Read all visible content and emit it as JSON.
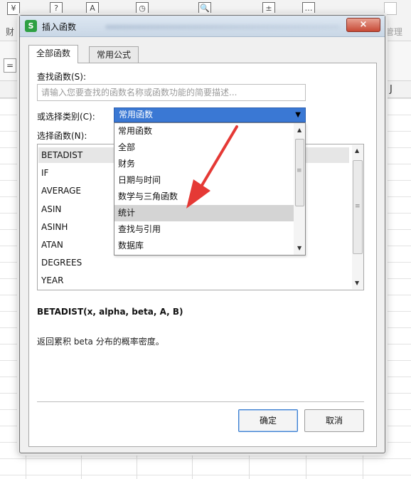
{
  "background": {
    "ribbon_labels": [
      "财",
      "管理"
    ],
    "ribbon_icons": [
      "¥",
      "?",
      "A",
      "◷",
      "🔍",
      "±",
      "…"
    ],
    "formula_prefix": "=",
    "column_label": "J"
  },
  "dialog": {
    "title": "插入函数",
    "close_glyph": "×",
    "tabs": [
      "全部函数",
      "常用公式"
    ],
    "search_label": "查找函数(S):",
    "search_placeholder": "请输入您要查找的函数名称或函数功能的简要描述...",
    "category_label": "或选择类别(C):",
    "category_selected": "常用函数",
    "function_label": "选择函数(N):",
    "functions": [
      "BETADIST",
      "IF",
      "AVERAGE",
      "ASIN",
      "ASINH",
      "ATAN",
      "DEGREES",
      "YEAR"
    ],
    "category_options": [
      "常用函数",
      "全部",
      "财务",
      "日期与时间",
      "数学与三角函数",
      "统计",
      "查找与引用",
      "数据库"
    ],
    "highlighted_option": "统计",
    "signature": "BETADIST(x, alpha, beta, A, B)",
    "description": "返回累积 beta 分布的概率密度。",
    "ok_label": "确定",
    "cancel_label": "取消"
  },
  "colors": {
    "select_blue": "#3a78d4",
    "arrow_red": "#e53935",
    "app_icon_green": "#2ea043"
  }
}
